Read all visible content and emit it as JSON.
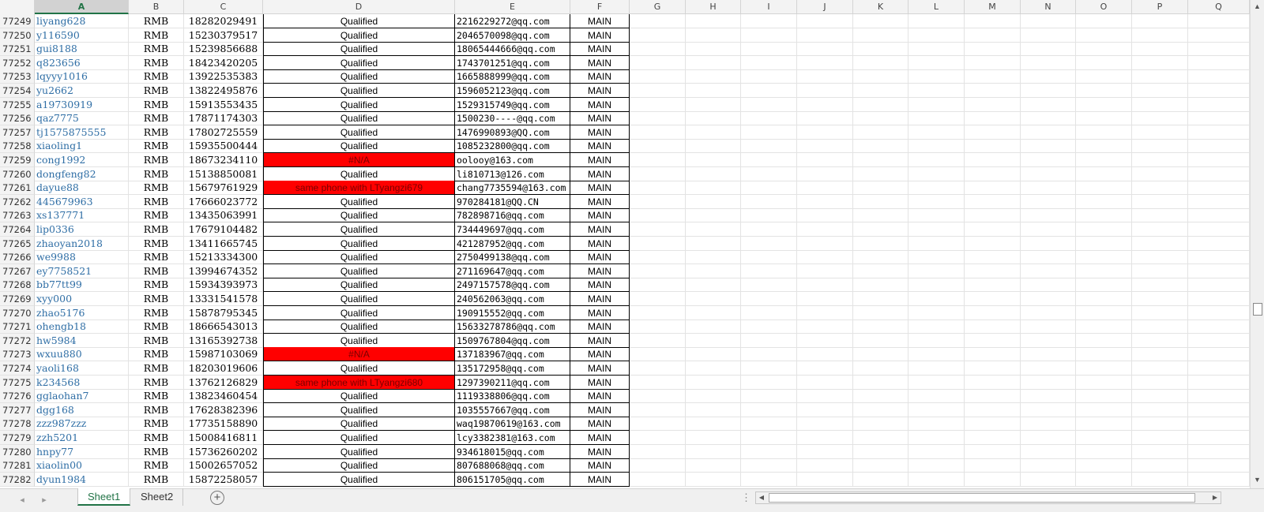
{
  "columns": [
    "A",
    "B",
    "C",
    "D",
    "E",
    "F",
    "G",
    "H",
    "I",
    "J",
    "K",
    "L",
    "M",
    "N",
    "O",
    "P",
    "Q"
  ],
  "active_column": "A",
  "rows": [
    {
      "n": "77249",
      "a": "liyang628",
      "b": "RMB",
      "c": "18282029491",
      "d": "Qualified",
      "d_red": false,
      "e": "2216229272@qq.com",
      "f": "MAIN"
    },
    {
      "n": "77250",
      "a": "y116590",
      "b": "RMB",
      "c": "15230379517",
      "d": "Qualified",
      "d_red": false,
      "e": "2046570098@qq.com",
      "f": "MAIN"
    },
    {
      "n": "77251",
      "a": "gui8188",
      "b": "RMB",
      "c": "15239856688",
      "d": "Qualified",
      "d_red": false,
      "e": "18065444666@qq.com",
      "f": "MAIN"
    },
    {
      "n": "77252",
      "a": "q823656",
      "b": "RMB",
      "c": "18423420205",
      "d": "Qualified",
      "d_red": false,
      "e": "1743701251@qq.com",
      "f": "MAIN"
    },
    {
      "n": "77253",
      "a": "lqyyy1016",
      "b": "RMB",
      "c": "13922535383",
      "d": "Qualified",
      "d_red": false,
      "e": "1665888999@qq.com",
      "f": "MAIN"
    },
    {
      "n": "77254",
      "a": "yu2662",
      "b": "RMB",
      "c": "13822495876",
      "d": "Qualified",
      "d_red": false,
      "e": "1596052123@qq.com",
      "f": "MAIN"
    },
    {
      "n": "77255",
      "a": "a19730919",
      "b": "RMB",
      "c": "15913553435",
      "d": "Qualified",
      "d_red": false,
      "e": "1529315749@qq.com",
      "f": "MAIN"
    },
    {
      "n": "77256",
      "a": "qaz7775",
      "b": "RMB",
      "c": "17871174303",
      "d": "Qualified",
      "d_red": false,
      "e": "1500230----@qq.com",
      "f": "MAIN"
    },
    {
      "n": "77257",
      "a": "tj1575875555",
      "b": "RMB",
      "c": "17802725559",
      "d": "Qualified",
      "d_red": false,
      "e": "1476990893@QQ.com",
      "f": "MAIN"
    },
    {
      "n": "77258",
      "a": "xiaoling1",
      "b": "RMB",
      "c": "15935500444",
      "d": "Qualified",
      "d_red": false,
      "e": "1085232800@qq.com",
      "f": "MAIN"
    },
    {
      "n": "77259",
      "a": "cong1992",
      "b": "RMB",
      "c": "18673234110",
      "d": "#N/A",
      "d_red": true,
      "e": "oolooy@163.com",
      "f": "MAIN"
    },
    {
      "n": "77260",
      "a": "dongfeng82",
      "b": "RMB",
      "c": "15138850081",
      "d": "Qualified",
      "d_red": false,
      "e": "li810713@126.com",
      "f": "MAIN"
    },
    {
      "n": "77261",
      "a": "dayue88",
      "b": "RMB",
      "c": "15679761929",
      "d": "same phone with LTyangzi679",
      "d_red": true,
      "e": "chang7735594@163.com",
      "f": "MAIN"
    },
    {
      "n": "77262",
      "a": "445679963",
      "b": "RMB",
      "c": "17666023772",
      "d": "Qualified",
      "d_red": false,
      "e": "970284181@QQ.CN",
      "f": "MAIN"
    },
    {
      "n": "77263",
      "a": "xs137771",
      "b": "RMB",
      "c": "13435063991",
      "d": "Qualified",
      "d_red": false,
      "e": "782898716@qq.com",
      "f": "MAIN"
    },
    {
      "n": "77264",
      "a": "lip0336",
      "b": "RMB",
      "c": "17679104482",
      "d": "Qualified",
      "d_red": false,
      "e": "734449697@qq.com",
      "f": "MAIN"
    },
    {
      "n": "77265",
      "a": "zhaoyan2018",
      "b": "RMB",
      "c": "13411665745",
      "d": "Qualified",
      "d_red": false,
      "e": "421287952@qq.com",
      "f": "MAIN"
    },
    {
      "n": "77266",
      "a": "we9988",
      "b": "RMB",
      "c": "15213334300",
      "d": "Qualified",
      "d_red": false,
      "e": "2750499138@qq.com",
      "f": "MAIN"
    },
    {
      "n": "77267",
      "a": "ey7758521",
      "b": "RMB",
      "c": "13994674352",
      "d": "Qualified",
      "d_red": false,
      "e": "271169647@qq.com",
      "f": "MAIN"
    },
    {
      "n": "77268",
      "a": "bb77tt99",
      "b": "RMB",
      "c": "15934393973",
      "d": "Qualified",
      "d_red": false,
      "e": "2497157578@qq.com",
      "f": "MAIN"
    },
    {
      "n": "77269",
      "a": "xyy000",
      "b": "RMB",
      "c": "13331541578",
      "d": "Qualified",
      "d_red": false,
      "e": "240562063@qq.com",
      "f": "MAIN"
    },
    {
      "n": "77270",
      "a": "zhao5176",
      "b": "RMB",
      "c": "15878795345",
      "d": "Qualified",
      "d_red": false,
      "e": "190915552@qq.com",
      "f": "MAIN"
    },
    {
      "n": "77271",
      "a": "ohengb18",
      "b": "RMB",
      "c": "18666543013",
      "d": "Qualified",
      "d_red": false,
      "e": "15633278786@qq.com",
      "f": "MAIN"
    },
    {
      "n": "77272",
      "a": "hw5984",
      "b": "RMB",
      "c": "13165392738",
      "d": "Qualified",
      "d_red": false,
      "e": "1509767804@qq.com",
      "f": "MAIN"
    },
    {
      "n": "77273",
      "a": "wxuu880",
      "b": "RMB",
      "c": "15987103069",
      "d": "#N/A",
      "d_red": true,
      "e": "137183967@qq.com",
      "f": "MAIN"
    },
    {
      "n": "77274",
      "a": "yaoli168",
      "b": "RMB",
      "c": "18203019606",
      "d": "Qualified",
      "d_red": false,
      "e": "135172958@qq.com",
      "f": "MAIN"
    },
    {
      "n": "77275",
      "a": "k234568",
      "b": "RMB",
      "c": "13762126829",
      "d": "same phone with LTyangzi680",
      "d_red": true,
      "e": "1297390211@qq.com",
      "f": "MAIN"
    },
    {
      "n": "77276",
      "a": "gglaohan7",
      "b": "RMB",
      "c": "13823460454",
      "d": "Qualified",
      "d_red": false,
      "e": "1119338806@qq.com",
      "f": "MAIN"
    },
    {
      "n": "77277",
      "a": "dgg168",
      "b": "RMB",
      "c": "17628382396",
      "d": "Qualified",
      "d_red": false,
      "e": "1035557667@qq.com",
      "f": "MAIN"
    },
    {
      "n": "77278",
      "a": "zzz987zzz",
      "b": "RMB",
      "c": "17735158890",
      "d": "Qualified",
      "d_red": false,
      "e": "waq19870619@163.com",
      "f": "MAIN"
    },
    {
      "n": "77279",
      "a": "zzh5201",
      "b": "RMB",
      "c": "15008416811",
      "d": "Qualified",
      "d_red": false,
      "e": "lcy3382381@163.com",
      "f": "MAIN"
    },
    {
      "n": "77280",
      "a": "hnpy77",
      "b": "RMB",
      "c": "15736260202",
      "d": "Qualified",
      "d_red": false,
      "e": "934618015@qq.com",
      "f": "MAIN"
    },
    {
      "n": "77281",
      "a": "xiaolin00",
      "b": "RMB",
      "c": "15002657052",
      "d": "Qualified",
      "d_red": false,
      "e": "807688068@qq.com",
      "f": "MAIN"
    },
    {
      "n": "77282",
      "a": "dyun1984",
      "b": "RMB",
      "c": "15872258057",
      "d": "Qualified",
      "d_red": false,
      "e": "806151705@qq.com",
      "f": "MAIN"
    }
  ],
  "sheets": [
    {
      "label": "Sheet1",
      "active": true
    },
    {
      "label": "Sheet2",
      "active": false
    }
  ],
  "bottom": {
    "add_sheet_glyph": "+",
    "dots": "⋮",
    "prev_sheet_glyph": "◂",
    "next_sheet_glyph": "▸"
  },
  "scroll": {
    "up_glyph": "▲",
    "down_glyph": "▼",
    "left_glyph": "◀",
    "right_glyph": "▶"
  },
  "colors": {
    "accent_green": "#217346",
    "flag_red": "#ff0000",
    "link_blue": "#2f6ea5"
  }
}
